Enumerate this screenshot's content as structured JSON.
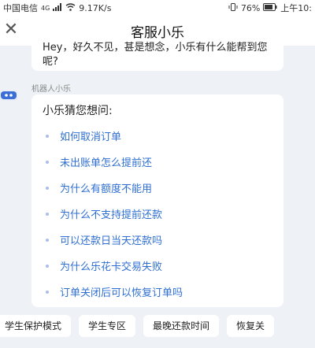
{
  "status_bar": {
    "carrier": "中国电信",
    "network": "4G",
    "speed": "9.17K/s",
    "battery": "76%",
    "time": "上午10:"
  },
  "header": {
    "title": "客服小乐"
  },
  "greeting": {
    "text": "Hey，好久不见，甚是想念，小乐有什么能帮到您呢?"
  },
  "bot": {
    "sender_label": "机器人小乐"
  },
  "suggest": {
    "title": "小乐猜您想问:",
    "questions": [
      "如何取消订单",
      "未出账单怎么提前还",
      "为什么有额度不能用",
      "为什么不支持提前还款",
      "可以还款日当天还款吗",
      "为什么乐花卡交易失败",
      "订单关闭后可以恢复订单吗"
    ]
  },
  "quick_replies": [
    "学生保护模式",
    "学生专区",
    "最晚还款时间",
    "恢复关"
  ],
  "colors": {
    "link": "#2f6fd1",
    "background": "#eef1f5",
    "card": "#ffffff"
  }
}
